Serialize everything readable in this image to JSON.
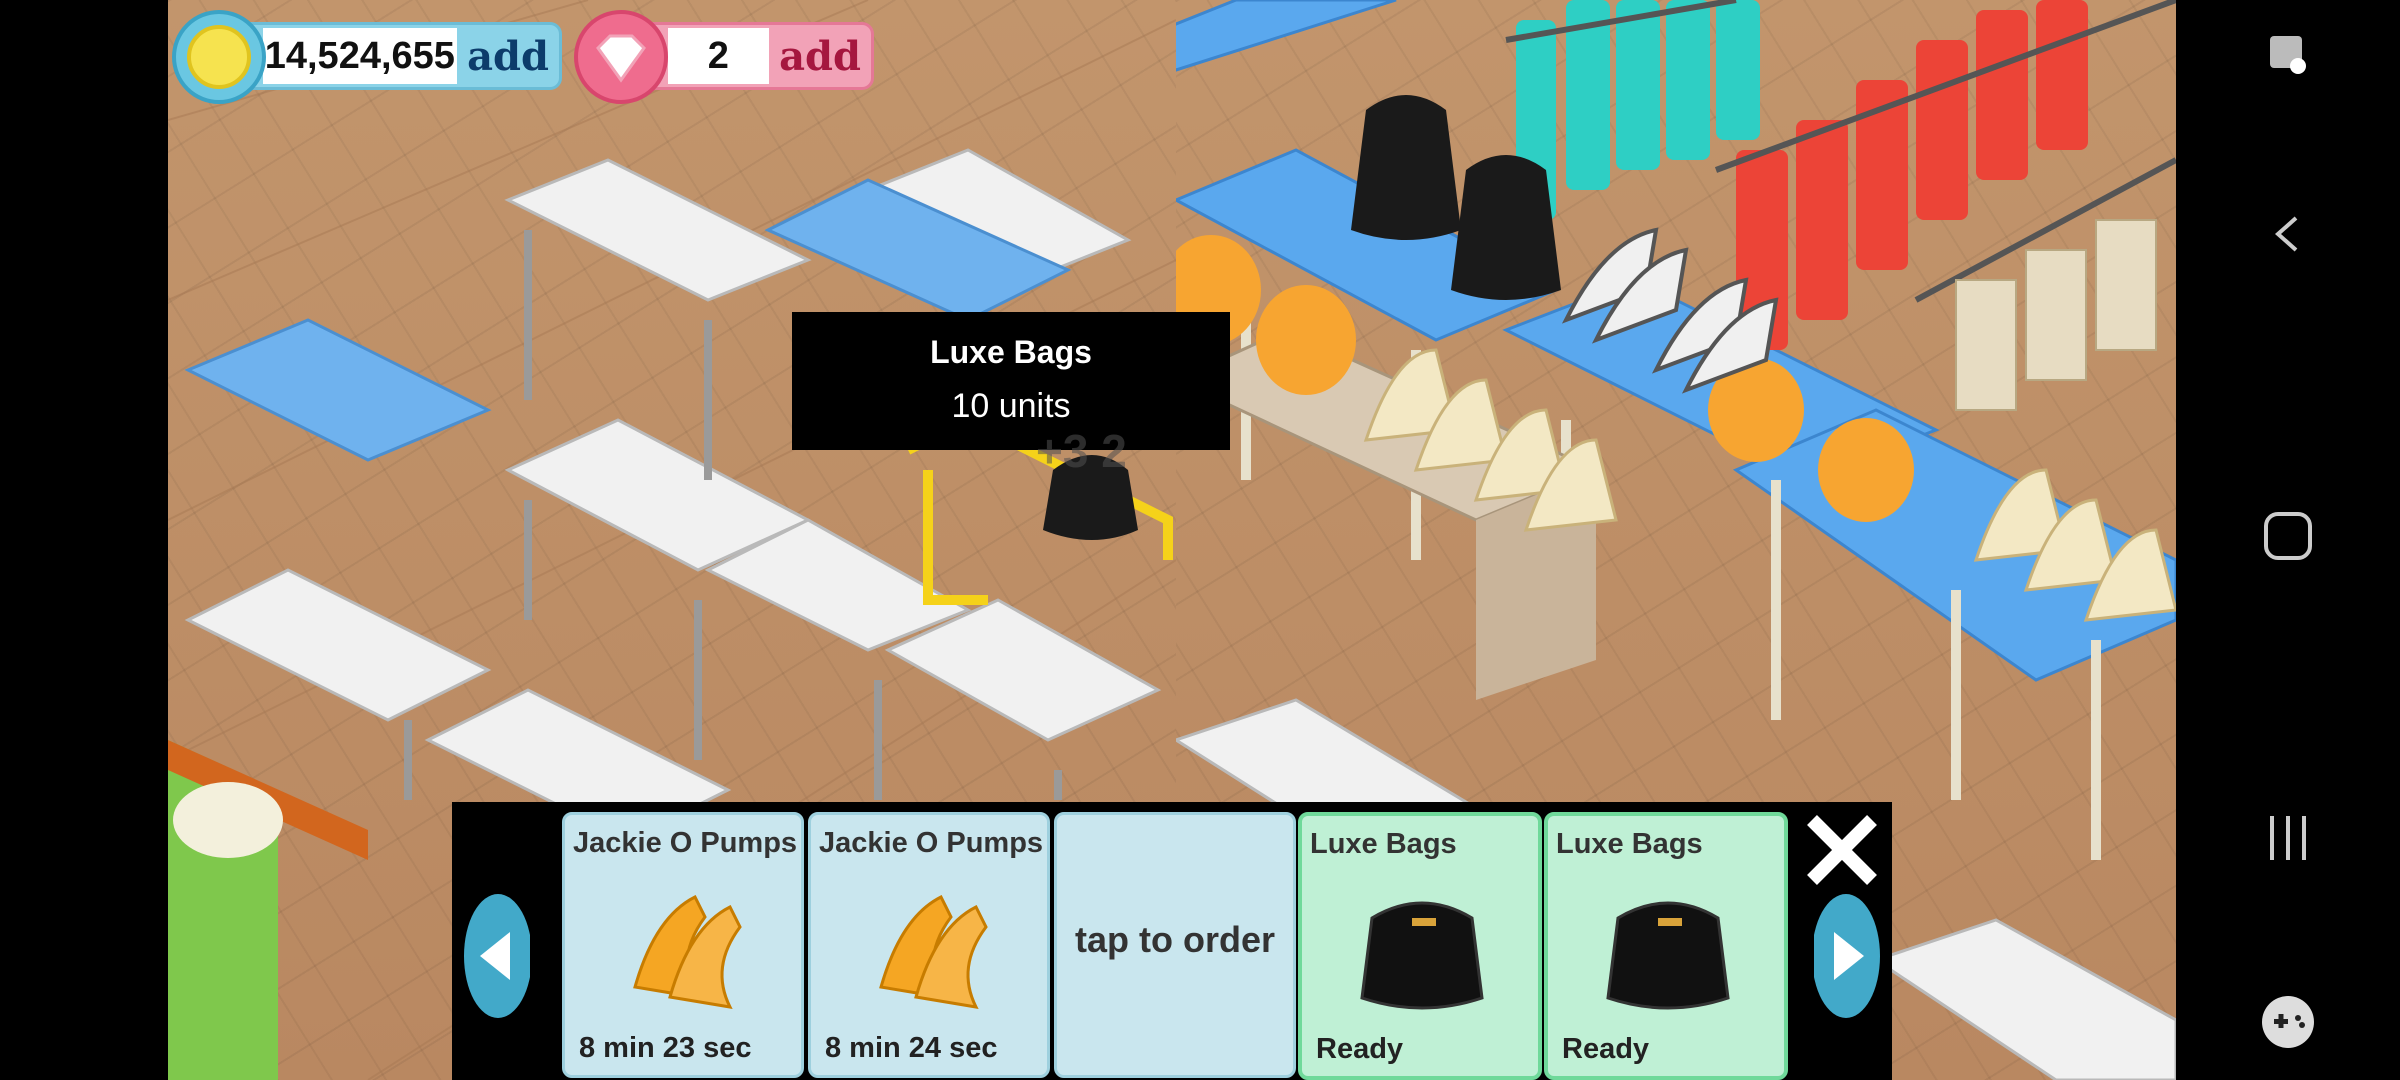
{
  "hud": {
    "coins": "14,524,655",
    "coins_add": "add",
    "gems": "2",
    "gems_add": "add"
  },
  "tooltip": {
    "title": "Luxe Bags",
    "subtitle": "10 units"
  },
  "float_text": "+3 2",
  "orders": {
    "cards": [
      {
        "name": "Jackie O Pumps",
        "status": "8 min 23 sec",
        "icon": "pumps-icon"
      },
      {
        "name": "Jackie O Pumps",
        "status": "8 min 24 sec",
        "icon": "pumps-icon"
      },
      {
        "name": "",
        "status": "tap to order",
        "icon": ""
      },
      {
        "name": "Luxe Bags",
        "status": "Ready",
        "icon": "handbag-icon"
      },
      {
        "name": "Luxe Bags",
        "status": "Ready",
        "icon": "handbag-icon"
      }
    ],
    "close_label": "X"
  },
  "colors": {
    "coin_bar": "#8bd3e8",
    "gem_bar": "#f2a2b7",
    "ready_card": "#bff0d5",
    "pending_card": "#c9e6ee"
  }
}
